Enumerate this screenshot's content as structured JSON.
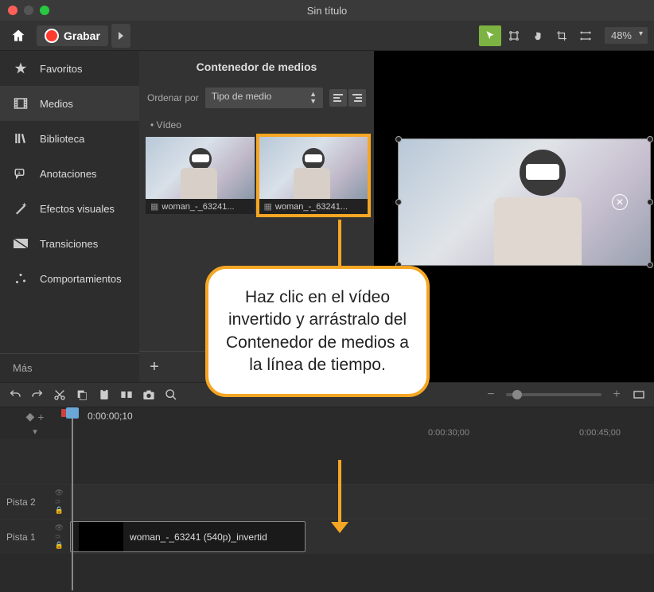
{
  "window": {
    "title": "Sin título"
  },
  "toolbar": {
    "record_label": "Grabar",
    "zoom": "48%"
  },
  "sidebar": {
    "items": [
      {
        "label": "Favoritos"
      },
      {
        "label": "Medios"
      },
      {
        "label": "Biblioteca"
      },
      {
        "label": "Anotaciones"
      },
      {
        "label": "Efectos visuales"
      },
      {
        "label": "Transiciones"
      },
      {
        "label": "Comportamientos"
      }
    ],
    "more_label": "Más"
  },
  "media": {
    "header": "Contenedor de medios",
    "sort_label": "Ordenar por",
    "sort_value": "Tipo de medio",
    "category": "Vídeo",
    "thumbs": [
      {
        "label": "woman_-_63241..."
      },
      {
        "label": "woman_-_63241..."
      }
    ]
  },
  "timeline": {
    "timecode": "0:00:00;10",
    "ruler_labels": [
      "0:00:30;00",
      "0:00:45;00"
    ],
    "tracks": [
      {
        "name": "Pista 2"
      },
      {
        "name": "Pista 1"
      }
    ],
    "clip_label": "woman_-_63241 (540p)_invertid"
  },
  "callout": {
    "text": "Haz clic en el vídeo invertido y arrástralo del Contenedor de medios a la línea de tiempo."
  }
}
